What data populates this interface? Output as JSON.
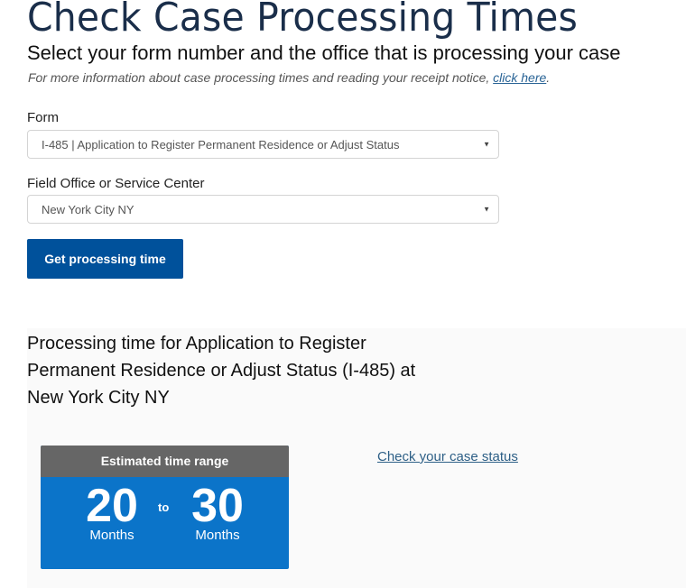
{
  "header": {
    "title": "Check Case Processing Times",
    "subtitle": "Select your form number and the office that is processing your case",
    "info_text": "For more information about case processing times and reading your receipt notice, ",
    "info_link": "click here",
    "info_suffix": "."
  },
  "form": {
    "form_label": "Form",
    "form_value": "I-485 | Application to Register Permanent Residence or Adjust Status",
    "office_label": "Field Office or Service Center",
    "office_value": "New York City NY",
    "dropdown_icon": "▼",
    "submit_label": "Get processing time"
  },
  "result": {
    "heading": "Processing time for Application to Register Permanent Residence or Adjust Status (I-485) at New York City NY",
    "card_title": "Estimated time range",
    "low_value": "20",
    "low_unit": "Months",
    "to_word": "to",
    "high_value": "30",
    "high_unit": "Months",
    "status_link": "Check your case status"
  },
  "colors": {
    "title": "#1a2e4a",
    "button": "#00519b",
    "card_header": "#666666",
    "card_body": "#0b74c9",
    "link": "#2d5f86",
    "panel_bg": "#fafafa"
  }
}
